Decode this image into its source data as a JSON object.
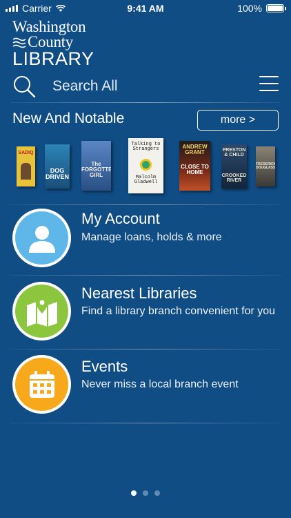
{
  "status_bar": {
    "carrier": "Carrier",
    "time": "9:41 AM",
    "battery": "100%"
  },
  "logo": {
    "line1": "Washington",
    "line2": "County",
    "line3": "LIBRARY"
  },
  "search": {
    "label": "Search All",
    "icon": "search-icon"
  },
  "menu_icon": "hamburger-menu-icon",
  "new_and_notable": {
    "title": "New And Notable",
    "more_label": "more >",
    "books": [
      {
        "title": "SADIQ",
        "color": "#e8c23a"
      },
      {
        "title": "DOG DRIVEN",
        "color": "#1f6f9c"
      },
      {
        "title": "The FORGOTTEN GIRL",
        "color": "#3b6aa6"
      },
      {
        "title": "Talking to Strangers",
        "author": "Malcolm Gladwell",
        "color": "#f2f1ec"
      },
      {
        "title": "ANDREW GRANT",
        "subtitle": "CLOSE TO HOME",
        "color": "#7a2a16"
      },
      {
        "title": "PRESTON & CHILD",
        "subtitle": "CROOKED RIVER",
        "color": "#1c3550"
      },
      {
        "title": "FREDERICK DOUGLASS",
        "color": "#3b3a37"
      }
    ]
  },
  "entries": [
    {
      "title": "My Account",
      "subtitle": "Manage loans, holds & more",
      "icon": "person-icon",
      "color": "#5fb6e8"
    },
    {
      "title": "Nearest Libraries",
      "subtitle": "Find a library branch convenient for you",
      "icon": "map-pin-icon",
      "color": "#8cc63f"
    },
    {
      "title": "Events",
      "subtitle": "Never miss a local branch event",
      "icon": "calendar-icon",
      "color": "#f7a81b"
    }
  ],
  "pager": {
    "pages": 3,
    "current": 1
  }
}
